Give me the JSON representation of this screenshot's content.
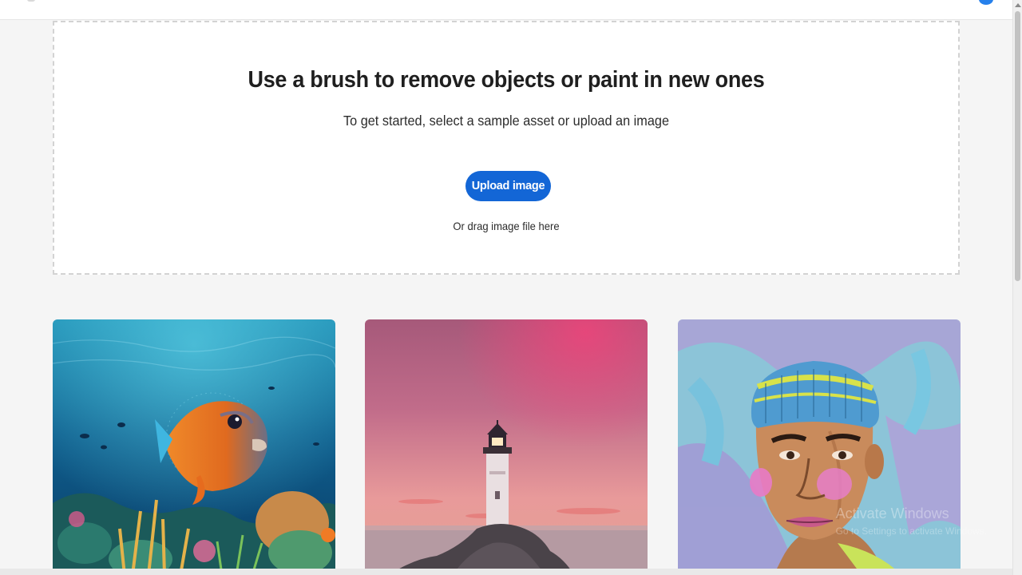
{
  "hero": {
    "title": "Use a brush to remove objects or paint in new ones",
    "subtitle": "To get started, select a sample asset or upload an image",
    "upload_button": "Upload image",
    "drag_hint": "Or drag image file here"
  },
  "samples": [
    {
      "label": "Underwater fish sample image"
    },
    {
      "label": "Lighthouse at sunset sample image"
    },
    {
      "label": "Portrait with beanie sample image"
    }
  ],
  "watermark": {
    "line1": "Activate Windows",
    "line2": "Go to Settings to activate Windows."
  },
  "colors": {
    "accent": "#1366d6",
    "background": "#f5f5f5"
  }
}
